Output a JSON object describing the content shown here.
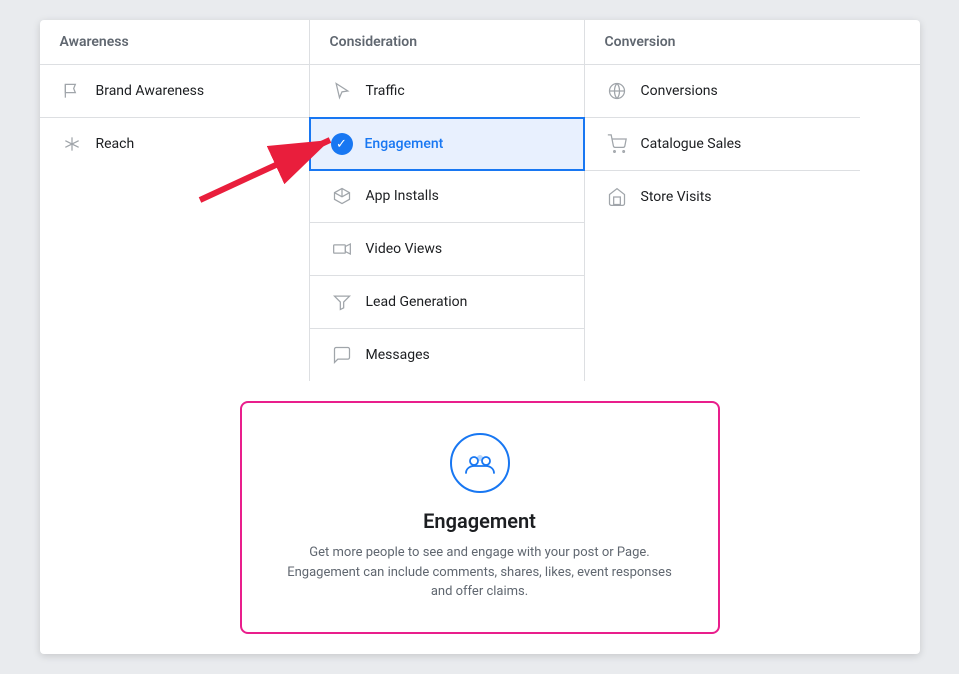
{
  "columns": {
    "awareness": {
      "header": "Awareness",
      "items": [
        {
          "id": "brand-awareness",
          "label": "Brand Awareness",
          "icon": "flag"
        },
        {
          "id": "reach",
          "label": "Reach",
          "icon": "asterisk"
        }
      ]
    },
    "consideration": {
      "header": "Consideration",
      "items": [
        {
          "id": "traffic",
          "label": "Traffic",
          "icon": "cursor"
        },
        {
          "id": "engagement",
          "label": "Engagement",
          "icon": "check",
          "selected": true
        },
        {
          "id": "app-installs",
          "label": "App Installs",
          "icon": "box"
        },
        {
          "id": "video-views",
          "label": "Video Views",
          "icon": "video"
        },
        {
          "id": "lead-generation",
          "label": "Lead Generation",
          "icon": "filter"
        },
        {
          "id": "messages",
          "label": "Messages",
          "icon": "chat"
        }
      ]
    },
    "conversion": {
      "header": "Conversion",
      "items": [
        {
          "id": "conversions",
          "label": "Conversions",
          "icon": "globe"
        },
        {
          "id": "catalogue-sales",
          "label": "Catalogue Sales",
          "icon": "cart"
        },
        {
          "id": "store-visits",
          "label": "Store Visits",
          "icon": "store"
        }
      ]
    }
  },
  "card": {
    "title": "Engagement",
    "description": "Get more people to see and engage with your post or Page. Engagement can include comments, shares, likes, event responses and offer claims."
  }
}
